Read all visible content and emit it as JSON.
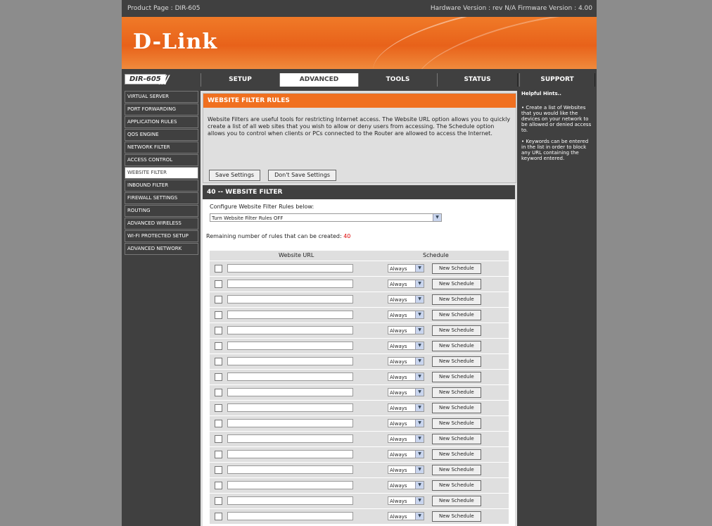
{
  "topbar": {
    "product": "Product Page : DIR-605",
    "versions": "Hardware Version : rev N/A   Firmware Version : 4.00"
  },
  "brand": {
    "logo": "D-Link"
  },
  "model": {
    "name": "DIR-605",
    "slashes": "///"
  },
  "tabs": [
    {
      "label": "SETUP"
    },
    {
      "label": "ADVANCED"
    },
    {
      "label": "TOOLS"
    },
    {
      "label": "STATUS"
    },
    {
      "label": "SUPPORT"
    }
  ],
  "sidebar": {
    "items": [
      {
        "label": "VIRTUAL SERVER"
      },
      {
        "label": "PORT FORWARDING"
      },
      {
        "label": "APPLICATION RULES"
      },
      {
        "label": "QOS ENGINE"
      },
      {
        "label": "NETWORK FILTER"
      },
      {
        "label": "ACCESS CONTROL"
      },
      {
        "label": "WEBSITE FILTER"
      },
      {
        "label": "INBOUND FILTER"
      },
      {
        "label": "FIREWALL SETTINGS"
      },
      {
        "label": "ROUTING"
      },
      {
        "label": "ADVANCED WIRELESS"
      },
      {
        "label": "WI-FI PROTECTED SETUP"
      },
      {
        "label": "ADVANCED NETWORK"
      }
    ]
  },
  "rules": {
    "title": "WEBSITE FILTER RULES",
    "description": "Website Filters are useful tools for restricting Internet access. The Website URL option allows you to quickly create a list of all web sites that you wish to allow or deny users from accessing. The Schedule option allows you to control when clients or PCs connected to the Router are allowed to access the Internet.",
    "save_label": "Save Settings",
    "dont_save_label": "Don't Save Settings"
  },
  "filter": {
    "title": "40 -- WEBSITE FILTER",
    "configure_label": "Configure Website Filter Rules below:",
    "mode_value": "Turn Website Filter Rules OFF",
    "remaining_label": "Remaining number of rules that can be created:",
    "remaining_count": "40",
    "col_url": "Website URL",
    "col_schedule": "Schedule",
    "schedule_value": "Always",
    "new_schedule_label": "New Schedule",
    "rows": 17
  },
  "help": {
    "title": "Helpful Hints..",
    "hint1": "•  Create a list of Websites that you would like the devices on your network to be allowed or denied access to.",
    "hint2": "•  Keywords can be entered in the list in order to block any URL containing the keyword entered."
  }
}
